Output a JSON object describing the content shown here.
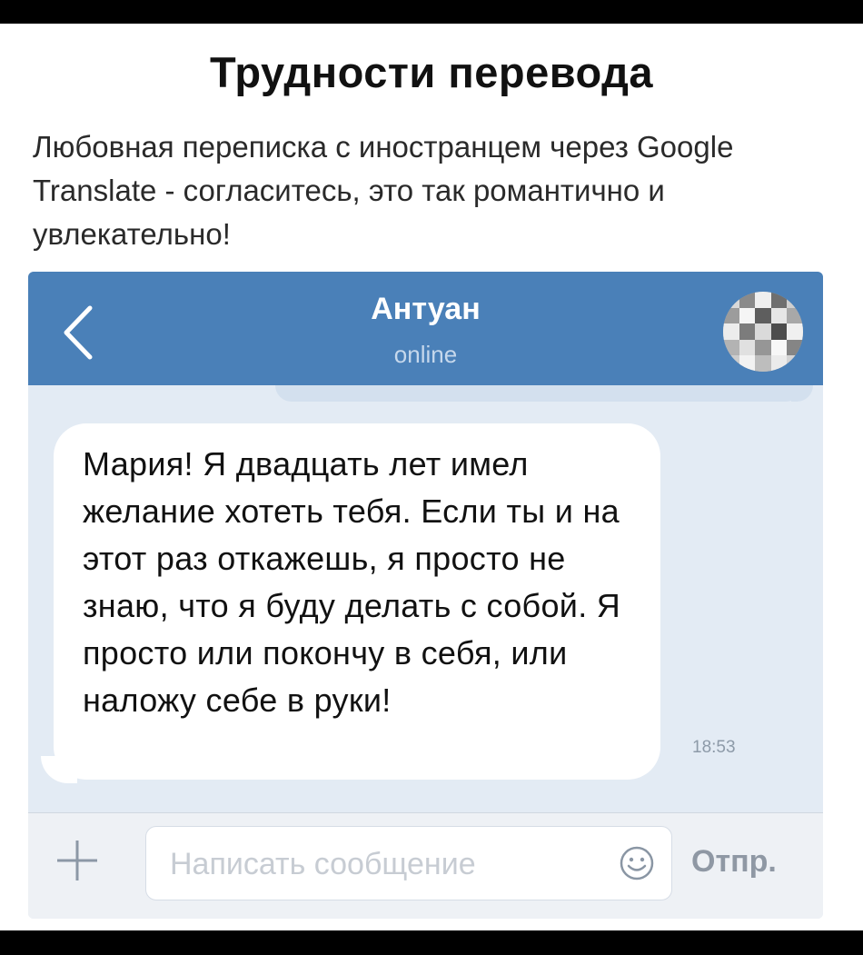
{
  "post": {
    "title": "Трудности перевода",
    "subtitle": "Любовная переписка с иностранцем через Google Translate - согласитесь, это так романтично и увлекательно!"
  },
  "chat": {
    "header": {
      "contact_name": "Антуан",
      "status": "online",
      "back_icon": "chevron-left-icon",
      "avatar": "pixelated-avatar"
    },
    "message": {
      "text": "Мария! Я двадцать лет имел желание хотеть тебя. Если ты и на этот раз откажешь, я просто не знаю, что я буду делать с собой. Я просто или покончу в себя, или наложу себе в руки!",
      "time": "18:53"
    },
    "compose": {
      "placeholder": "Написать сообщение",
      "send_label": "Отпр.",
      "attach_icon": "plus-icon",
      "emoji_icon": "smiley-icon"
    }
  },
  "colors": {
    "header_bg": "#4a80b8",
    "chat_bg": "#e3ebf4",
    "bubble_bg": "#ffffff",
    "compose_bg": "#eef1f5"
  }
}
